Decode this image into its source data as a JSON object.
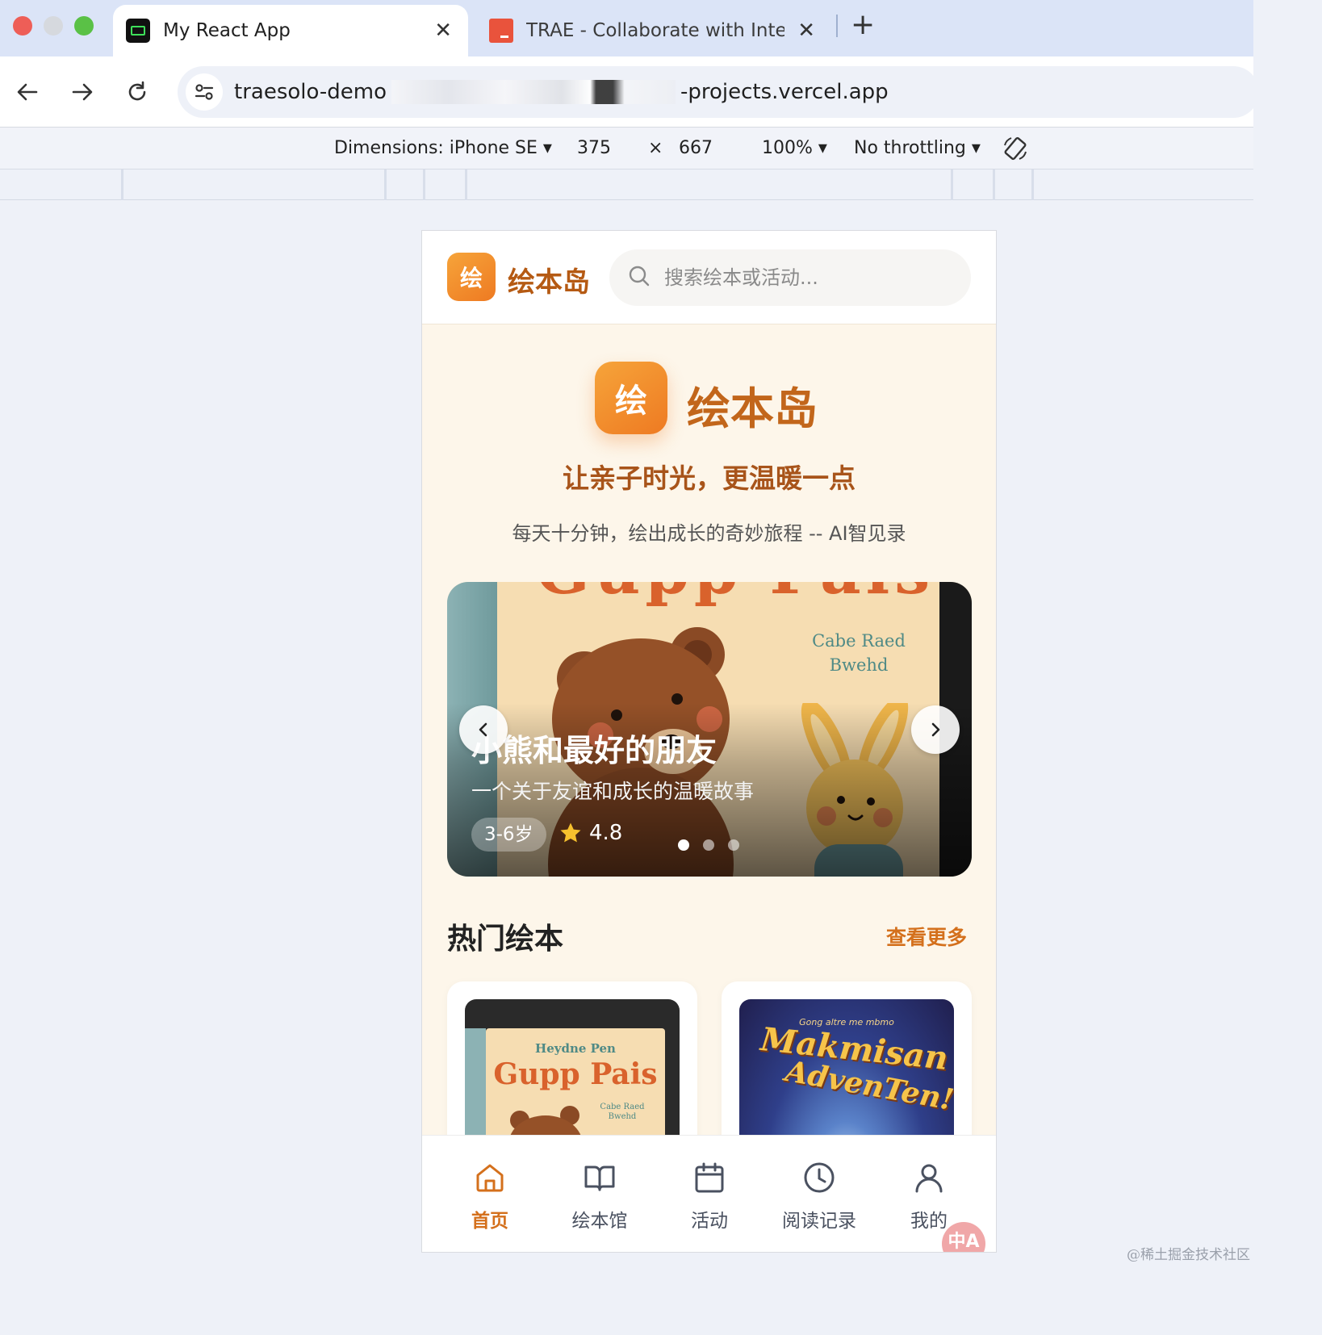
{
  "browser": {
    "tabs": [
      {
        "title": "My React App",
        "active": true
      },
      {
        "title": "TRAE - Collaborate with Intelli",
        "active": false
      }
    ],
    "url_prefix": "traesolo-demo",
    "url_suffix": "-projects.vercel.app",
    "devtools": {
      "device": "Dimensions: iPhone SE",
      "width": "375",
      "times": "×",
      "height": "667",
      "zoom": "100%",
      "throttling": "No throttling"
    },
    "accent": "#dbe4f7"
  },
  "app": {
    "logo_char": "绘",
    "brand": "绘本岛",
    "search_placeholder": "搜索绘本或活动...",
    "hero": {
      "logo_char": "绘",
      "brand": "绘本岛",
      "slogan": "让亲子时光，更温暖一点",
      "subslogan": "每天十分钟，绘出成长的奇妙旅程 -- AI智见录"
    },
    "carousel": {
      "title": "小熊和最好的朋友",
      "subtitle": "一个关于友谊和成长的温暖故事",
      "age": "3-6岁",
      "rating": "4.8",
      "cover_top_text": "Gupp Pais",
      "cover_author": "Cabe Raed Bwehd",
      "slides": 3,
      "current_slide": 1
    },
    "section": {
      "title": "热门绘本",
      "more": "查看更多"
    },
    "books": [
      {
        "author": "Heydne Pen",
        "title": "Gupp Pais",
        "small": "Cabe Raed Bwehd"
      },
      {
        "tag": "Gong altre me mbmo",
        "title_line1": "Makmisan",
        "title_line2": "AdvenTen!"
      }
    ],
    "nav": [
      {
        "label": "首页",
        "icon": "home-icon",
        "active": true
      },
      {
        "label": "绘本馆",
        "icon": "book-icon",
        "active": false
      },
      {
        "label": "活动",
        "icon": "calendar-icon",
        "active": false
      },
      {
        "label": "阅读记录",
        "icon": "clock-icon",
        "active": false
      },
      {
        "label": "我的",
        "icon": "user-icon",
        "active": false
      }
    ],
    "ime_badge": "中A",
    "accent": "#d4701c"
  },
  "watermark": "@稀土掘金技术社区"
}
